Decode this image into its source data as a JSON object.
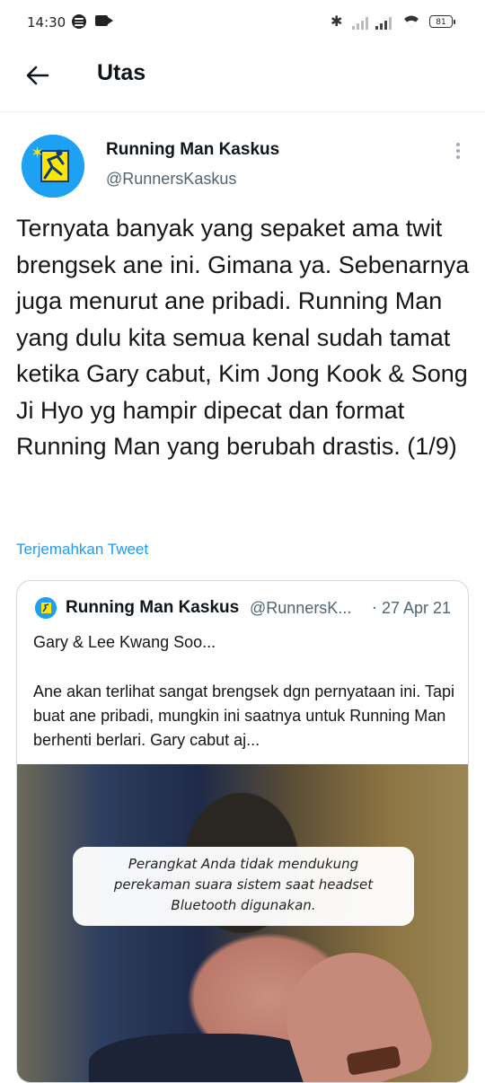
{
  "status_bar": {
    "time": "14:30",
    "battery": "81"
  },
  "header": {
    "title": "Utas"
  },
  "tweet": {
    "author_name": "Running Man Kaskus",
    "author_handle": "@RunnersKaskus",
    "text": "Ternyata banyak yang sepaket ama twit brengsek ane ini. Gimana ya. Sebenarnya juga menurut ane pribadi. Running Man yang dulu kita semua kenal sudah tamat ketika Gary cabut, Kim Jong Kook & Song Ji Hyo yg hampir dipecat dan format Running Man yang berubah drastis. (1/9)",
    "translate_label": "Terjemahkan Tweet"
  },
  "quoted_tweet": {
    "author_name": "Running Man Kaskus",
    "author_handle": "@RunnersK...",
    "date": "27 Apr 21",
    "line1": "Gary & Lee Kwang Soo...",
    "line2": "Ane akan terlihat sangat brengsek dgn pernyataan ini. Tapi buat ane pribadi, mungkin ini saatnya untuk Running Man berhenti berlari. Gary cabut aj..."
  },
  "toast": {
    "line1": "Perangkat Anda tidak mendukung",
    "line2": "perekaman suara sistem saat headset",
    "line3": "Bluetooth digunakan."
  },
  "colors": {
    "link": "#1d9bf0",
    "secondary_text": "#536471",
    "brand_avatar": "#1da1f2"
  }
}
